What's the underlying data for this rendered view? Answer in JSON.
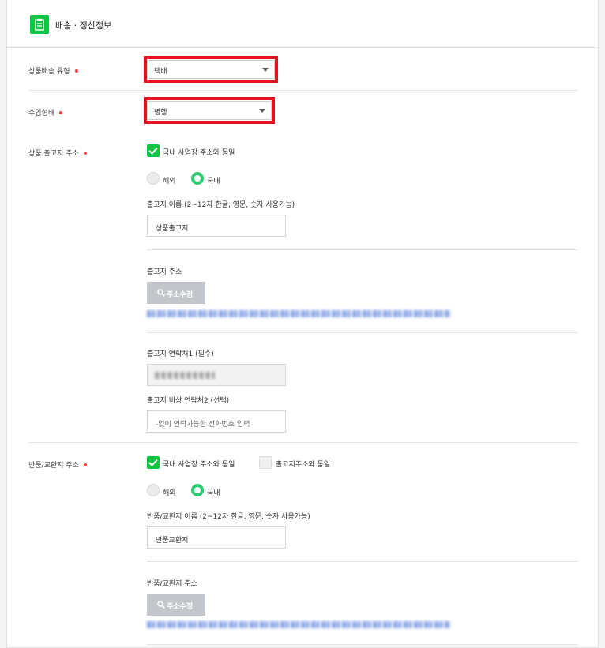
{
  "header": {
    "title": "배송 · 정산정보"
  },
  "shipping_type": {
    "label": "상품배송 유형",
    "value": "택배"
  },
  "import_type": {
    "label": "수입형태",
    "value": "병행"
  },
  "release": {
    "label": "상품 출고지 주소",
    "same_as_domestic": "국내 사업장 주소와 동일",
    "radio_overseas": "해외",
    "radio_domestic": "국내",
    "name_label": "출고지 이름 (2~12자 한글, 영문, 숫자 사용가능)",
    "name_value": "상품출고지",
    "address_label": "출고지 주소",
    "address_button": "주소수정",
    "contact1_label": "출고지 연락처1 (필수)",
    "contact2_label": "출고지 비상 연락처2 (선택)",
    "contact2_placeholder": "-없이 연락가능한 전화번호 입력"
  },
  "return": {
    "label": "반품/교환지 주소",
    "same_as_domestic": "국내 사업장 주소와 동일",
    "same_as_release": "출고지주소와 동일",
    "radio_overseas": "해외",
    "radio_domestic": "국내",
    "name_label": "반품/교환지 이름 (2~12자 한글, 영문, 숫자 사용가능)",
    "name_value": "반품교환지",
    "address_label": "반품/교환지 주소",
    "address_button": "주소수정"
  },
  "colors": {
    "accent": "#10c542",
    "radio": "#2ecc71",
    "required": "#ff3b3b",
    "highlight": "#e4141f"
  }
}
